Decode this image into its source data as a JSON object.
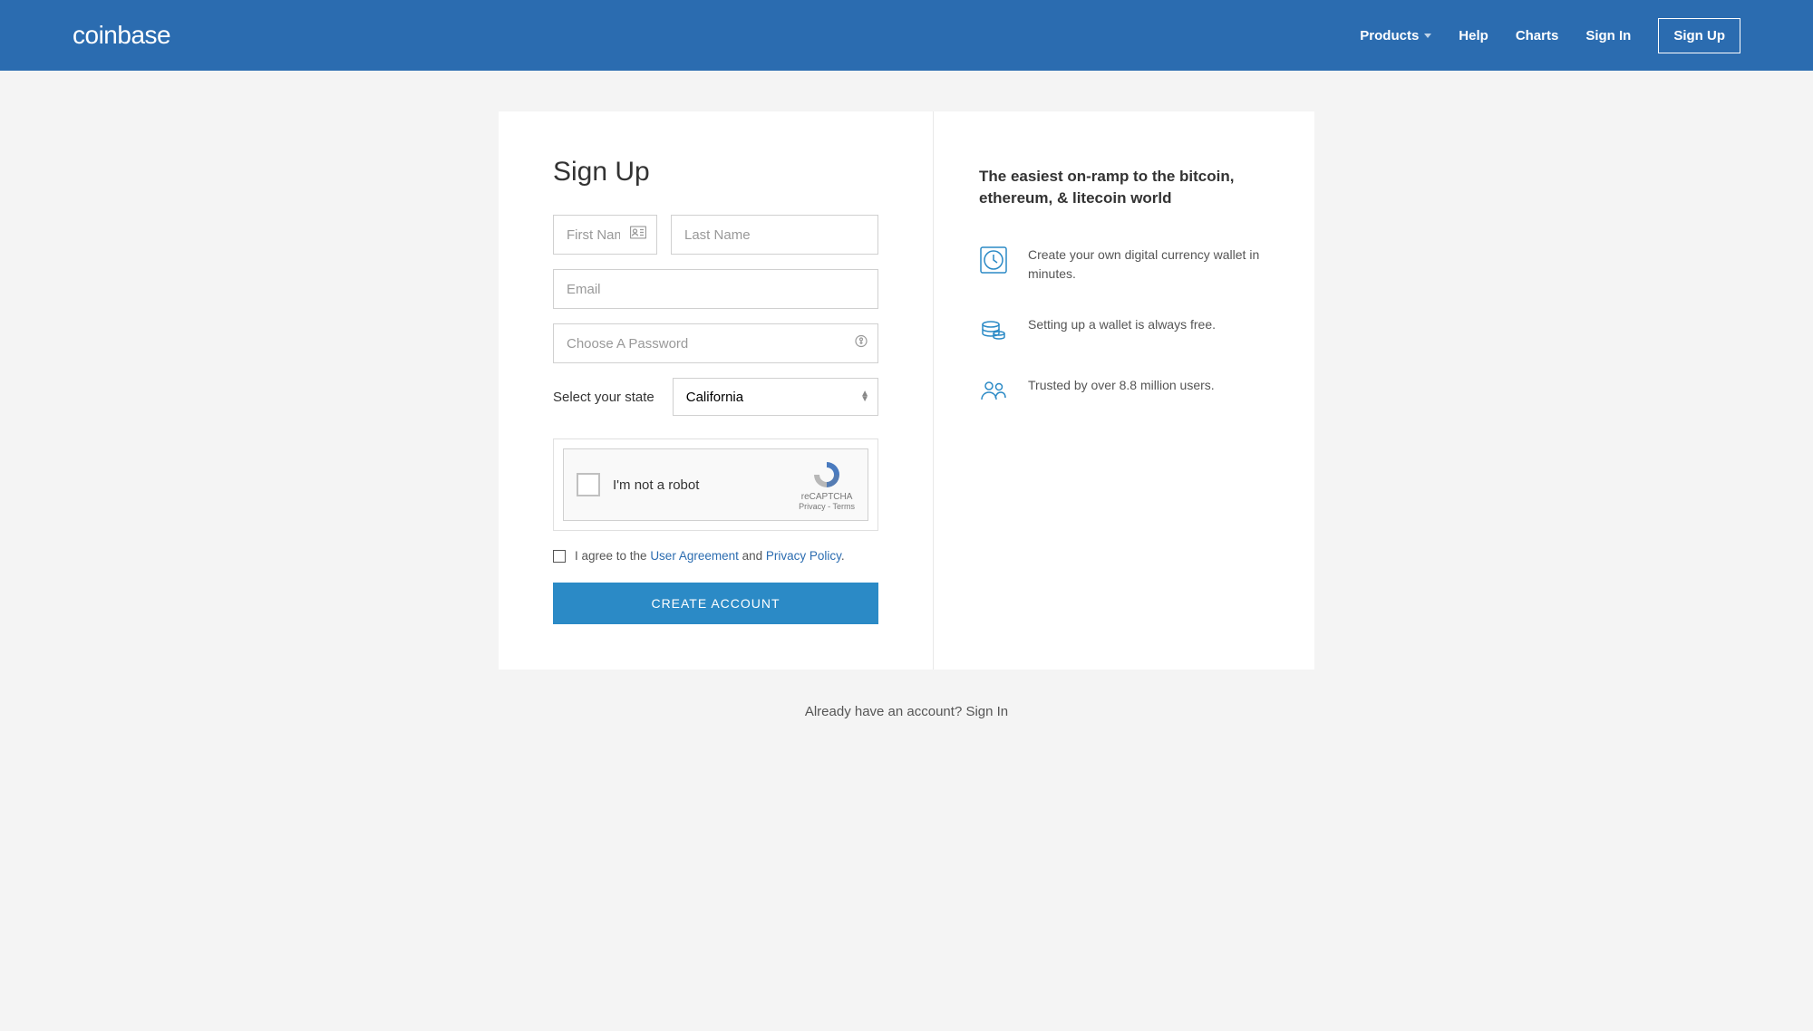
{
  "header": {
    "logo": "coinbase",
    "nav": {
      "products": "Products",
      "help": "Help",
      "charts": "Charts",
      "signin": "Sign In",
      "signup": "Sign Up"
    }
  },
  "form": {
    "title": "Sign Up",
    "first_name_placeholder": "First Name",
    "last_name_placeholder": "Last Name",
    "email_placeholder": "Email",
    "password_placeholder": "Choose A Password",
    "state_label": "Select your state",
    "state_value": "California",
    "captcha_text": "I'm not a robot",
    "captcha_brand": "reCAPTCHA",
    "captcha_links": "Privacy - Terms",
    "agree_prefix": "I agree to the ",
    "agree_link1": "User Agreement",
    "agree_mid": " and ",
    "agree_link2": "Privacy Policy",
    "agree_suffix": ".",
    "submit": "CREATE ACCOUNT"
  },
  "benefits": {
    "title": "The easiest on-ramp to the bitcoin, ethereum, & litecoin world",
    "items": [
      "Create your own digital currency wallet in minutes.",
      "Setting up a wallet is always free.",
      "Trusted by over 8.8 million users."
    ]
  },
  "footer": {
    "prefix": "Already have an account? ",
    "link": "Sign In"
  }
}
